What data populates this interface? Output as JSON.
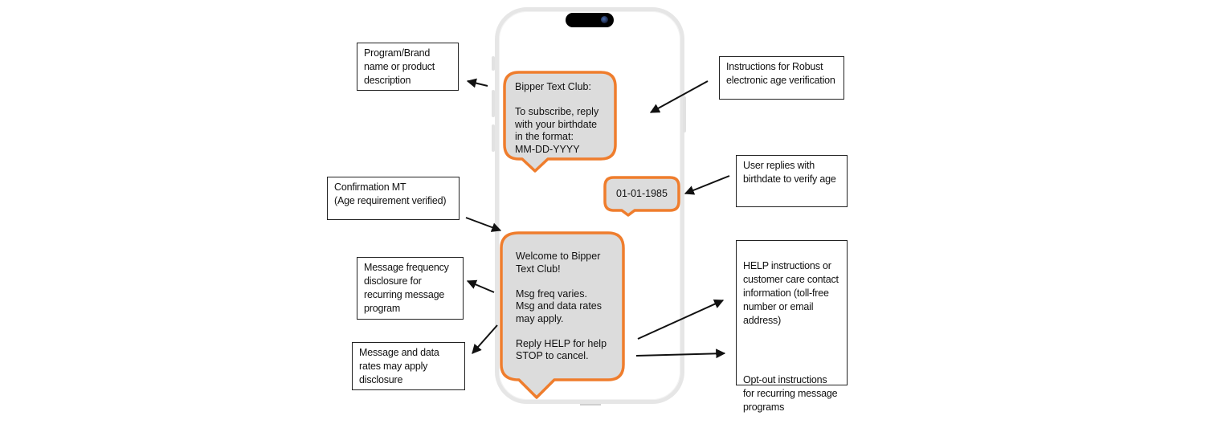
{
  "colors": {
    "bubble_border": "#ef7d2d",
    "bubble_fill": "#dcdcdc",
    "phone_frame": "#e6e6e6",
    "arrow": "#111111"
  },
  "phone": {
    "messages": [
      {
        "direction": "incoming",
        "text": "Bipper Text Club:\n\nTo subscribe, reply\nwith your birthdate\nin the format:\nMM-DD-YYYY"
      },
      {
        "direction": "outgoing",
        "text": "01-01-1985"
      },
      {
        "direction": "incoming",
        "text": "Welcome to Bipper\nText Club!\n\nMsg freq varies.\nMsg and data rates\nmay apply.\n\nReply HELP for help\nSTOP to cancel."
      }
    ]
  },
  "annotations": {
    "program_brand": "Program/Brand\nname or product\ndescription",
    "confirmation_mt": "Confirmation MT\n(Age requirement verified)",
    "msg_frequency": "Message frequency\ndisclosure for\nrecurring message\nprogram",
    "msg_data_rates": "Message and data\nrates may apply\ndisclosure",
    "age_verification": "Instructions for Robust\nelectronic age verification",
    "user_replies": "User replies with\nbirthdate to verify age",
    "help_instructions": "HELP instructions or\ncustomer care contact\ninformation (toll-free\nnumber or email\naddress)",
    "opt_out": "Opt-out instructions\nfor recurring message\nprograms"
  }
}
